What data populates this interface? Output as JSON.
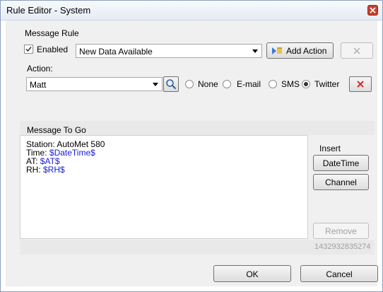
{
  "window": {
    "title": "Rule Editor - System"
  },
  "message_rule": {
    "group_label": "Message Rule",
    "enabled_label": "Enabled",
    "enabled_checked": true,
    "rule_selected": "New Data Available",
    "add_action_label": "Add Action"
  },
  "action": {
    "label": "Action:",
    "contact_selected": "Matt",
    "options": [
      "None",
      "E-mail",
      "SMS",
      "Twitter"
    ],
    "selected_option": "Twitter"
  },
  "message": {
    "group_label": "Message To Go",
    "lines": [
      {
        "text": "Station: AutoMet 580",
        "token": ""
      },
      {
        "text": "Time: ",
        "token": "$DateTime$"
      },
      {
        "text": "AT: ",
        "token": "$AT$"
      },
      {
        "text": "RH: ",
        "token": "$RH$"
      }
    ]
  },
  "insert": {
    "label": "Insert",
    "datetime_label": "DateTime",
    "channel_label": "Channel",
    "remove_label": "Remove"
  },
  "id_number": "1432932835274",
  "footer": {
    "ok_label": "OK",
    "cancel_label": "Cancel"
  },
  "colors": {
    "token": "#1a1ad8",
    "close_red": "#c7402f",
    "disabled_text": "#a0a0a0"
  }
}
